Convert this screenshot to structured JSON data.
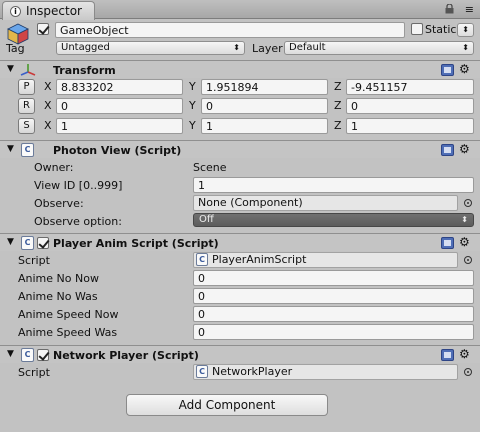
{
  "window": {
    "tab_title": "Inspector",
    "info_icon": "i",
    "menu_icon": "≡"
  },
  "gameobject": {
    "name": "GameObject",
    "active": true,
    "static_label": "Static",
    "static_checked": false,
    "tag_label": "Tag",
    "tag_value": "Untagged",
    "layer_label": "Layer",
    "layer_value": "Default"
  },
  "transform": {
    "title": "Transform",
    "position": {
      "button": "P",
      "x": "8.833202",
      "y": "1.951894",
      "z": "-9.451157"
    },
    "rotation": {
      "button": "R",
      "x": "0",
      "y": "0",
      "z": "0"
    },
    "scale": {
      "button": "S",
      "x": "1",
      "y": "1",
      "z": "1"
    },
    "axis_labels": {
      "x": "X",
      "y": "Y",
      "z": "Z"
    }
  },
  "photon_view": {
    "title": "Photon View (Script)",
    "owner_label": "Owner:",
    "owner_value": "Scene",
    "view_id_label": "View ID [0..999]",
    "view_id_value": "1",
    "observe_label": "Observe:",
    "observe_value": "None (Component)",
    "observe_option_label": "Observe option:",
    "observe_option_value": "Off"
  },
  "player_anim": {
    "title": "Player Anim Script (Script)",
    "enabled": true,
    "script_label": "Script",
    "script_value": "PlayerAnimScript",
    "fields": [
      {
        "label": "Anime No Now",
        "value": "0"
      },
      {
        "label": "Anime No Was",
        "value": "0"
      },
      {
        "label": "Anime Speed Now",
        "value": "0"
      },
      {
        "label": "Anime Speed Was",
        "value": "0"
      }
    ]
  },
  "network_player": {
    "title": "Network Player (Script)",
    "enabled": true,
    "script_label": "Script",
    "script_value": "NetworkPlayer"
  },
  "add_component_label": "Add Component",
  "icons": {
    "dropdown_arrow": "⬍",
    "foldout_open": "▼",
    "gear": "⚙",
    "script_glyph": "C"
  },
  "colors": {
    "panel_bg": "#c2c2c2",
    "help_blue": "#4f6eb6",
    "dark_dropdown": "#656565"
  }
}
